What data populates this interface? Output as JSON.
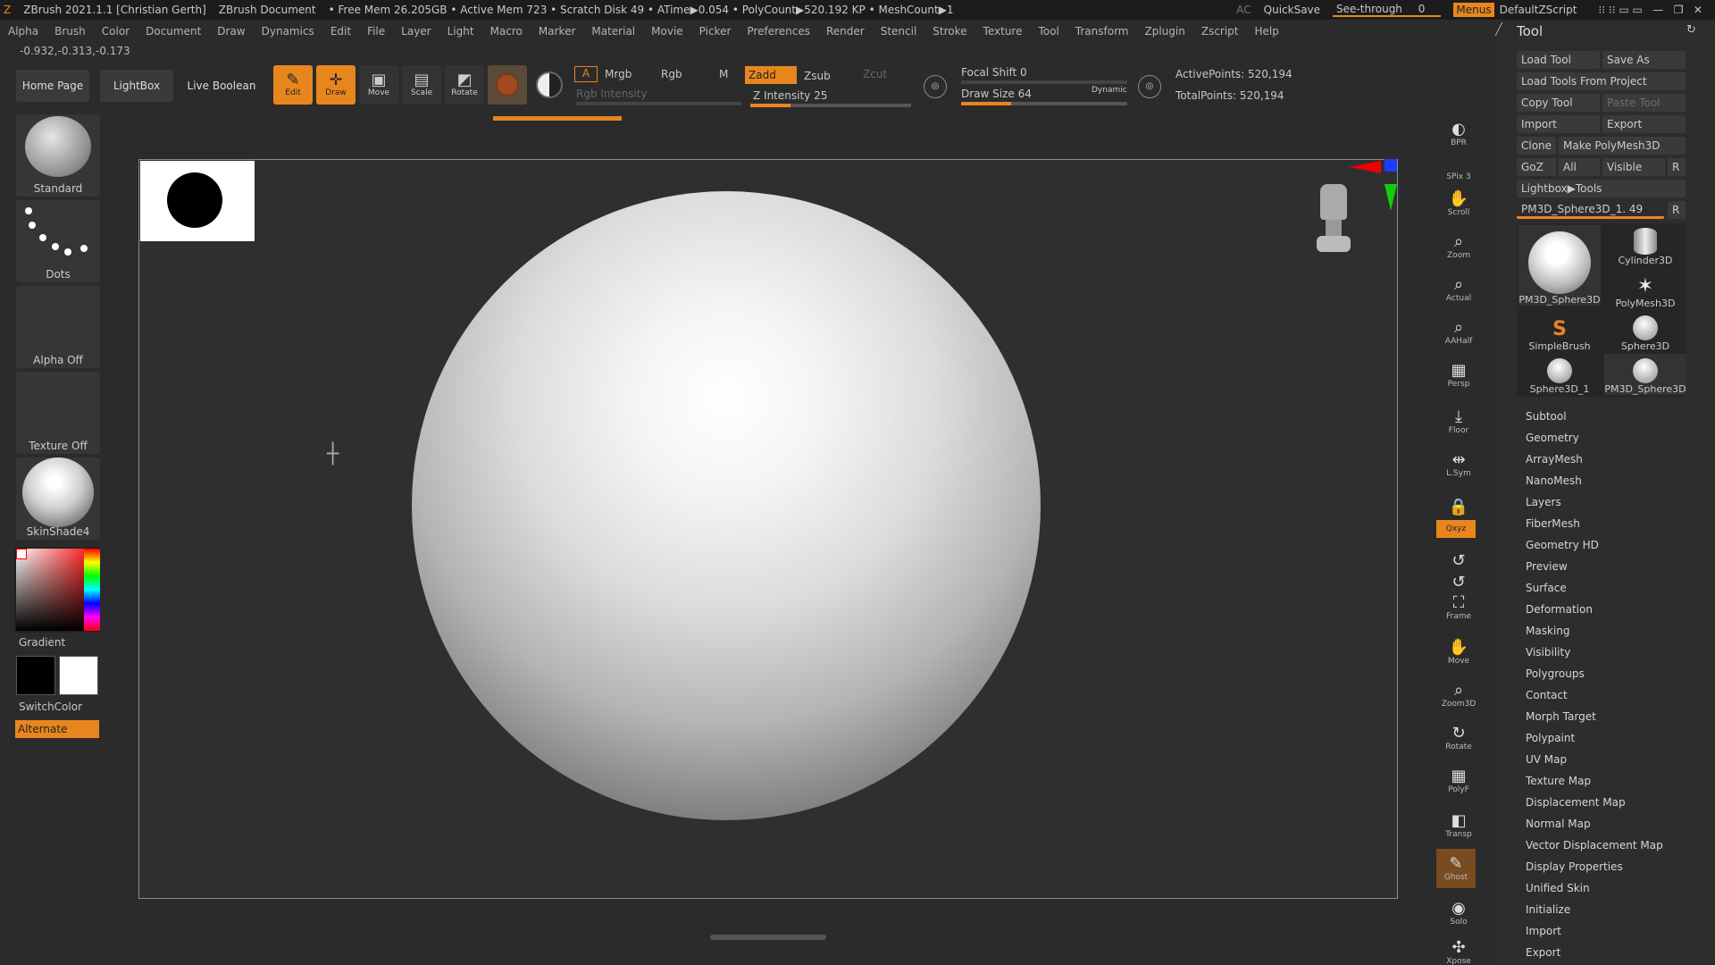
{
  "titlebar": {
    "app": "ZBrush 2021.1.1 [Christian Gerth]",
    "doc": "ZBrush Document",
    "stats": "• Free Mem 26.205GB • Active Mem 723 • Scratch Disk 49 • ATime▶0.054 • PolyCount▶520.192 KP • MeshCount▶1",
    "ac": "AC",
    "quicksave": "QuickSave",
    "seethrough": "See-through",
    "seethrough_val": "0",
    "menus": "Menus",
    "script": "DefaultZScript"
  },
  "menu": [
    "Alpha",
    "Brush",
    "Color",
    "Document",
    "Draw",
    "Dynamics",
    "Edit",
    "File",
    "Layer",
    "Light",
    "Macro",
    "Marker",
    "Material",
    "Movie",
    "Picker",
    "Preferences",
    "Render",
    "Stencil",
    "Stroke",
    "Texture",
    "Tool",
    "Transform",
    "Zplugin",
    "Zscript",
    "Help"
  ],
  "coords": "-0.932,-0.313,-0.173",
  "shelf": {
    "home": "Home Page",
    "lightbox": "LightBox",
    "live_boolean": "Live Boolean"
  },
  "tools": {
    "edit": "Edit",
    "draw": "Draw",
    "move": "Move",
    "scale": "Scale",
    "rotate": "Rotate"
  },
  "color": {
    "a": "A",
    "mrgb": "Mrgb",
    "rgb": "Rgb",
    "m": "M",
    "rgb_intensity": "Rgb Intensity",
    "zadd": "Zadd",
    "zsub": "Zsub",
    "zcut": "Zcut",
    "z_intensity": "Z Intensity 25"
  },
  "brush": {
    "focal_shift": "Focal Shift 0",
    "draw_size": "Draw Size 64",
    "dynamic": "Dynamic",
    "active_points": "ActivePoints: 520,194",
    "total_points": "TotalPoints: 520,194"
  },
  "left": {
    "brush": "Standard",
    "stroke": "Dots",
    "alpha": "Alpha Off",
    "texture": "Texture Off",
    "material": "SkinShade4",
    "gradient": "Gradient",
    "switch": "SwitchColor",
    "alternate": "Alternate"
  },
  "right_tools": [
    "BPR",
    "SPix 3",
    "Scroll",
    "Zoom",
    "Actual",
    "AAHalf",
    "Persp",
    "Floor",
    "L.Sym",
    "",
    "Qxyz",
    "",
    "",
    "Frame",
    "Move",
    "Zoom3D",
    "Rotate",
    "PolyF",
    "Transp",
    "Ghost",
    "Solo",
    "Xpose"
  ],
  "tool_panel": {
    "title": "Tool",
    "load_tool": "Load Tool",
    "save_as": "Save As",
    "load_from_project": "Load Tools From Project",
    "copy_tool": "Copy Tool",
    "paste_tool": "Paste Tool",
    "import": "Import",
    "export": "Export",
    "clone": "Clone",
    "make_polymesh": "Make PolyMesh3D",
    "goz": "GoZ",
    "all": "All",
    "visible": "Visible",
    "r": "R",
    "lightbox_tools": "Lightbox▶Tools",
    "current": "PM3D_Sphere3D_1. 49",
    "thumbs": [
      "PM3D_Sphere3D",
      "Cylinder3D",
      "PolyMesh3D",
      "SimpleBrush",
      "Sphere3D",
      "Sphere3D_1",
      "PM3D_Sphere3D"
    ],
    "items": [
      "Subtool",
      "Geometry",
      "ArrayMesh",
      "NanoMesh",
      "Layers",
      "FiberMesh",
      "Geometry HD",
      "Preview",
      "Surface",
      "Deformation",
      "Masking",
      "Visibility",
      "Polygroups",
      "Contact",
      "Morph Target",
      "Polypaint",
      "UV Map",
      "Texture Map",
      "Displacement Map",
      "Normal Map",
      "Vector Displacement Map",
      "Display Properties",
      "Unified Skin",
      "Initialize",
      "Import",
      "Export"
    ]
  },
  "colors": {
    "accent": "#e8861e",
    "bg": "#2b2b2b"
  },
  "sliders": {
    "z_intensity": 0.25,
    "draw_size": 0.3,
    "focal_shift": 0.5,
    "spix": 0.3
  }
}
